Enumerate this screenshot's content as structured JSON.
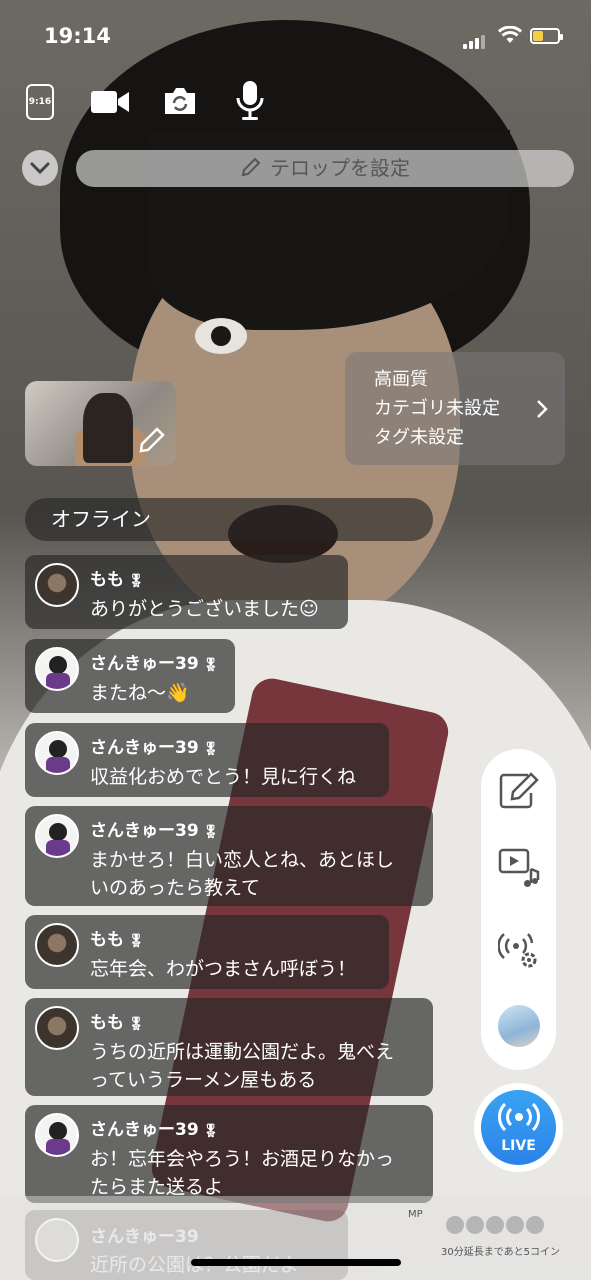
{
  "status_bar": {
    "time": "19:14"
  },
  "top_toolbar": {
    "ratio_label": "9:16"
  },
  "telop": {
    "placeholder": "テロップを設定"
  },
  "stream_settings": {
    "quality": "高画質",
    "category": "カテゴリ未設定",
    "tags": "タグ未設定"
  },
  "connection": {
    "status": "オフライン"
  },
  "comments": [
    {
      "name": "もも",
      "text": "ありがとうございました☺",
      "avatar": "momo"
    },
    {
      "name": "さんきゅー39",
      "text": "またね〜👋",
      "avatar": "san"
    },
    {
      "name": "さんきゅー39",
      "text": "収益化おめでとう！見に行くね",
      "avatar": "san"
    },
    {
      "name": "さんきゅー39",
      "text": "まかせろ！白い恋人とね、あとほしいのあったら教えて",
      "line1": "まかせろ！白い恋人とね、あとほし",
      "line2": "いのあったら教えて",
      "avatar": "san"
    },
    {
      "name": "もも",
      "text": "忘年会、わがつまさん呼ぼう！",
      "avatar": "momo"
    },
    {
      "name": "もも",
      "text": "うちの近所は運動公園だよ。鬼べえっていうラーメン屋もある",
      "line1": "うちの近所は運動公園だよ。鬼べえ",
      "line2": "っていうラーメン屋もある",
      "avatar": "momo"
    },
    {
      "name": "さんきゅー39",
      "text": "お！忘年会やろう！お酒足りなかったらまた送るよ",
      "line1": "お！忘年会やろう！お酒足りなかっ",
      "line2": "たらまた送るよ",
      "avatar": "san"
    },
    {
      "name": "さんきゅー39",
      "text": "近所の公園は？公園だよ",
      "avatar": "san"
    }
  ],
  "side_bar": {
    "icons": [
      "edit-icon",
      "music-video-icon",
      "broadcast-settings-icon",
      "profile-avatar"
    ]
  },
  "live_button": {
    "label": "LIVE"
  },
  "footer": {
    "mp_label": "MP",
    "extend_text": "30分延長まであと5コイン"
  }
}
